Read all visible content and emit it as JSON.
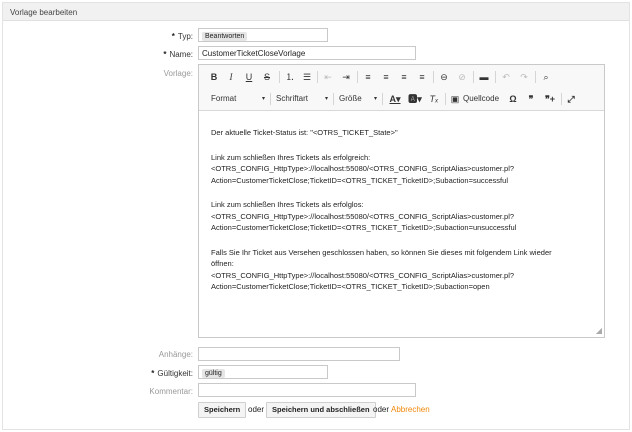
{
  "panel": {
    "title": "Vorlage bearbeiten"
  },
  "form": {
    "type_label": "Typ:",
    "type_value": "Beantworten",
    "name_label": "Name:",
    "name_value": "CustomerTicketCloseVorlage",
    "template_label": "Vorlage:",
    "attachments_label": "Anhänge:",
    "validity_label": "Gültigkeit:",
    "validity_value": "gültig",
    "comment_label": "Kommentar:",
    "required_star": "*"
  },
  "toolbar": {
    "bold": "B",
    "italic": "I",
    "underline": "U",
    "strike": "S",
    "format_label": "Format",
    "font_label": "Schriftart",
    "size_label": "Größe",
    "source_label": "Quellcode",
    "dropdown_arrow": "▾"
  },
  "content": {
    "line1": "Der aktuelle Ticket-Status ist: \"<OTRS_TICKET_State>\"",
    "line2": "Link zum schließen Ihres Tickets als erfolgreich:",
    "line3": "<OTRS_CONFIG_HttpType>://localhost:55080/<OTRS_CONFIG_ScriptAlias>customer.pl?",
    "line4": "Action=CustomerTicketClose;TicketID=<OTRS_TICKET_TicketID>;Subaction=successful",
    "line5": "Link zum schließen Ihres Tickets als erfolglos:",
    "line6": "<OTRS_CONFIG_HttpType>://localhost:55080/<OTRS_CONFIG_ScriptAlias>customer.pl?",
    "line7": "Action=CustomerTicketClose;TicketID=<OTRS_TICKET_TicketID>;Subaction=unsuccessful",
    "line8": "Falls Sie Ihr Ticket aus Versehen geschlossen haben, so können Sie dieses mit folgendem Link wieder",
    "line9": "öffnen:",
    "line10": "<OTRS_CONFIG_HttpType>://localhost:55080/<OTRS_CONFIG_ScriptAlias>customer.pl?",
    "line11": "Action=CustomerTicketClose;TicketID=<OTRS_TICKET_TicketID>;Subaction=open"
  },
  "actions": {
    "save": "Speichern",
    "or1": "oder",
    "save_finish": "Speichern und abschließen",
    "or2": "oder",
    "cancel": "Abbrechen"
  }
}
